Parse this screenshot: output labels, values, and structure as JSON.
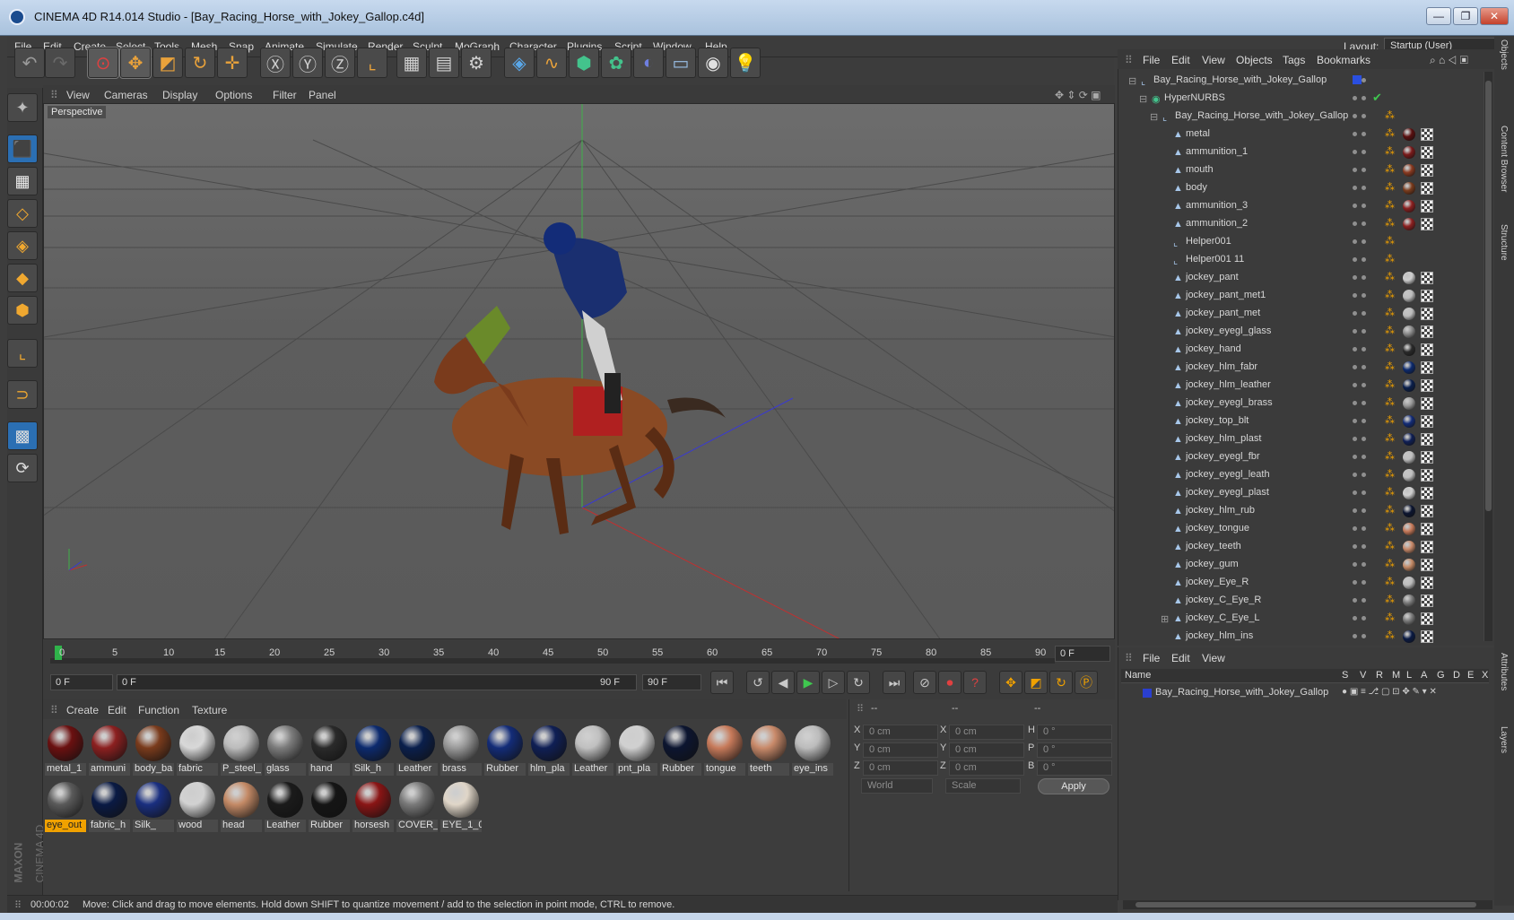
{
  "window": {
    "title": "CINEMA 4D R14.014 Studio - [Bay_Racing_Horse_with_Jokey_Gallop.c4d]",
    "min": "—",
    "max": "❐",
    "close": "✕"
  },
  "menu": [
    "File",
    "Edit",
    "Create",
    "Select",
    "Tools",
    "Mesh",
    "Snap",
    "Animate",
    "Simulate",
    "Render",
    "Sculpt",
    "MoGraph",
    "Character",
    "Plugins",
    "Script",
    "Window",
    "Help"
  ],
  "layout": {
    "label": "Layout:",
    "value": "Startup (User)"
  },
  "toolbar_icons": [
    "undo-icon",
    "redo-icon",
    "pointer-icon",
    "move-icon",
    "scale-icon",
    "rotate-icon",
    "move-all-icon",
    "x-axis-icon",
    "y-axis-icon",
    "z-axis-icon",
    "coord-system-icon",
    "render-view-icon",
    "render-picture-icon",
    "render-settings-icon",
    "cube-icon",
    "spline-icon",
    "nurbs-icon",
    "array-icon",
    "deformer-icon",
    "floor-icon",
    "camera-icon",
    "light-icon"
  ],
  "viewport": {
    "menu": [
      "View",
      "Cameras",
      "Display",
      "Options",
      "Filter",
      "Panel"
    ],
    "label": "Perspective"
  },
  "timeline": {
    "ticks": [
      "0",
      "5",
      "10",
      "15",
      "20",
      "25",
      "30",
      "35",
      "40",
      "45",
      "50",
      "55",
      "60",
      "65",
      "70",
      "75",
      "80",
      "85",
      "90"
    ],
    "current_frame": "0 F",
    "start": "0 F",
    "range_start": "0 F",
    "range_end": "90 F",
    "end": "90 F"
  },
  "materials": {
    "menu": [
      "Create",
      "Edit",
      "Function",
      "Texture"
    ],
    "row1": [
      {
        "name": "metal_1",
        "color": "#6b1010"
      },
      {
        "name": "ammuni",
        "color": "#8c2020"
      },
      {
        "name": "body_ba",
        "color": "#7a3b1c"
      },
      {
        "name": "fabric",
        "color": "#d8d8d8"
      },
      {
        "name": "P_steel_",
        "color": "#bcbcbc"
      },
      {
        "name": "glass",
        "color": "#7c7c7c"
      },
      {
        "name": "hand",
        "color": "#2a2a2a"
      },
      {
        "name": "Silk_h",
        "color": "#0c2a6e"
      },
      {
        "name": "Leather",
        "color": "#0a1f4c"
      },
      {
        "name": "brass",
        "color": "#9a9a9a"
      },
      {
        "name": "Rubber",
        "color": "#132c78"
      },
      {
        "name": "hlm_pla",
        "color": "#0f1f55"
      },
      {
        "name": "Leather",
        "color": "#c0c0c0"
      },
      {
        "name": "pnt_pla",
        "color": "#d0d0d0"
      },
      {
        "name": "Rubber",
        "color": "#0c1530"
      },
      {
        "name": "tongue",
        "color": "#c77a5a"
      },
      {
        "name": "teeth",
        "color": "#c98a6a"
      },
      {
        "name": "eye_ins",
        "color": "#bcbcbc"
      }
    ],
    "row2": [
      {
        "name": "eye_out",
        "color": "#5a5a5a",
        "selected": true
      },
      {
        "name": "fabric_h",
        "color": "#0a1a44"
      },
      {
        "name": "Silk_",
        "color": "#1a2f80"
      },
      {
        "name": "wood",
        "color": "#d2d2d2"
      },
      {
        "name": "head",
        "color": "#c48a66"
      },
      {
        "name": "Leather",
        "color": "#1b1b1b"
      },
      {
        "name": "Rubber",
        "color": "#151515"
      },
      {
        "name": "horsesh",
        "color": "#8a1515"
      },
      {
        "name": "COVER_",
        "color": "#7a7a7a"
      },
      {
        "name": "EYE_1_0(",
        "color": "#e0d6c8"
      }
    ]
  },
  "coords": {
    "headers": [
      "--",
      "--",
      "--"
    ],
    "rows": [
      {
        "l1": "X",
        "v1": "0 cm",
        "l2": "X",
        "v2": "0 cm",
        "l3": "H",
        "v3": "0 °"
      },
      {
        "l1": "Y",
        "v1": "0 cm",
        "l2": "Y",
        "v2": "0 cm",
        "l3": "P",
        "v3": "0 °"
      },
      {
        "l1": "Z",
        "v1": "0 cm",
        "l2": "Z",
        "v2": "0 cm",
        "l3": "B",
        "v3": "0 °"
      }
    ],
    "mode": "World",
    "type": "Scale",
    "apply": "Apply"
  },
  "objects": {
    "menu": [
      "File",
      "Edit",
      "View",
      "Objects",
      "Tags",
      "Bookmarks"
    ],
    "items": [
      {
        "name": "Bay_Racing_Horse_with_Jokey_Gallop",
        "indent": 0,
        "type": "null",
        "tex": false
      },
      {
        "name": "HyperNURBS",
        "indent": 1,
        "type": "nurbs",
        "tex": false
      },
      {
        "name": "Bay_Racing_Horse_with_Jokey_Gallop",
        "indent": 2,
        "type": "null",
        "tex": false
      },
      {
        "name": "metal",
        "indent": 3,
        "type": "poly",
        "tex": true,
        "tc": "#5a1010"
      },
      {
        "name": "ammunition_1",
        "indent": 3,
        "type": "poly",
        "tex": true,
        "tc": "#7a1a1a"
      },
      {
        "name": "mouth",
        "indent": 3,
        "type": "poly",
        "tex": true,
        "tc": "#8a3a20"
      },
      {
        "name": "body",
        "indent": 3,
        "type": "poly",
        "tex": true,
        "tc": "#7a3b1c"
      },
      {
        "name": "ammunition_3",
        "indent": 3,
        "type": "poly",
        "tex": true,
        "tc": "#8c2020"
      },
      {
        "name": "ammunition_2",
        "indent": 3,
        "type": "poly",
        "tex": true,
        "tc": "#8c2020"
      },
      {
        "name": "Helper001",
        "indent": 3,
        "type": "null",
        "tex": false
      },
      {
        "name": "Helper001 11",
        "indent": 3,
        "type": "null",
        "tex": false
      },
      {
        "name": "jockey_pant",
        "indent": 3,
        "type": "poly",
        "tex": true,
        "tc": "#cfcfcf"
      },
      {
        "name": "jockey_pant_met1",
        "indent": 3,
        "type": "poly",
        "tex": true,
        "tc": "#bdbdbd"
      },
      {
        "name": "jockey_pant_met",
        "indent": 3,
        "type": "poly",
        "tex": true,
        "tc": "#bdbdbd"
      },
      {
        "name": "jockey_eyegl_glass",
        "indent": 3,
        "type": "poly",
        "tex": true,
        "tc": "#8a8a8a"
      },
      {
        "name": "jockey_hand",
        "indent": 3,
        "type": "poly",
        "tex": true,
        "tc": "#2a2a2a"
      },
      {
        "name": "jockey_hlm_fabr",
        "indent": 3,
        "type": "poly",
        "tex": true,
        "tc": "#0c2a6e"
      },
      {
        "name": "jockey_hlm_leather",
        "indent": 3,
        "type": "poly",
        "tex": true,
        "tc": "#0a1f4c"
      },
      {
        "name": "jockey_eyegl_brass",
        "indent": 3,
        "type": "poly",
        "tex": true,
        "tc": "#9a9a9a"
      },
      {
        "name": "jockey_top_blt",
        "indent": 3,
        "type": "poly",
        "tex": true,
        "tc": "#132c78"
      },
      {
        "name": "jockey_hlm_plast",
        "indent": 3,
        "type": "poly",
        "tex": true,
        "tc": "#0f1f55"
      },
      {
        "name": "jockey_eyegl_fbr",
        "indent": 3,
        "type": "poly",
        "tex": true,
        "tc": "#c0c0c0"
      },
      {
        "name": "jockey_eyegl_leath",
        "indent": 3,
        "type": "poly",
        "tex": true,
        "tc": "#c0c0c0"
      },
      {
        "name": "jockey_eyegl_plast",
        "indent": 3,
        "type": "poly",
        "tex": true,
        "tc": "#d0d0d0"
      },
      {
        "name": "jockey_hlm_rub",
        "indent": 3,
        "type": "poly",
        "tex": true,
        "tc": "#0c1530"
      },
      {
        "name": "jockey_tongue",
        "indent": 3,
        "type": "poly",
        "tex": true,
        "tc": "#c77a5a"
      },
      {
        "name": "jockey_teeth",
        "indent": 3,
        "type": "poly",
        "tex": true,
        "tc": "#c98a6a"
      },
      {
        "name": "jockey_gum",
        "indent": 3,
        "type": "poly",
        "tex": true,
        "tc": "#c48a66"
      },
      {
        "name": "jockey_Eye_R",
        "indent": 3,
        "type": "poly",
        "tex": true,
        "tc": "#bcbcbc"
      },
      {
        "name": "jockey_C_Eye_R",
        "indent": 3,
        "type": "poly",
        "tex": true,
        "tc": "#7a7a7a"
      },
      {
        "name": "jockey_C_Eye_L",
        "indent": 3,
        "type": "poly",
        "tex": true,
        "tc": "#7a7a7a"
      },
      {
        "name": "jockey_hlm_ins",
        "indent": 3,
        "type": "poly",
        "tex": true,
        "tc": "#0a1a44"
      }
    ]
  },
  "attributes": {
    "menu": [
      "File",
      "Edit",
      "View"
    ],
    "columns": [
      "Name",
      "S",
      "V",
      "R",
      "M",
      "L",
      "A",
      "G",
      "D",
      "E",
      "X"
    ],
    "row": "Bay_Racing_Horse_with_Jokey_Gallop"
  },
  "side_tabs": [
    "Objects",
    "Content Browser",
    "Structure"
  ],
  "side_tabs_bottom": [
    "Attributes",
    "Layers"
  ],
  "maxon": [
    "MAXON",
    "CINEMA 4D"
  ],
  "status": {
    "time": "00:00:02",
    "message": "Move: Click and drag to move elements. Hold down SHIFT to quantize movement / add to the selection in point mode, CTRL to remove."
  },
  "colors": {
    "accent": "#f0a100",
    "bg": "#3d3d3d",
    "blue_sel": "#2b6fb3"
  }
}
